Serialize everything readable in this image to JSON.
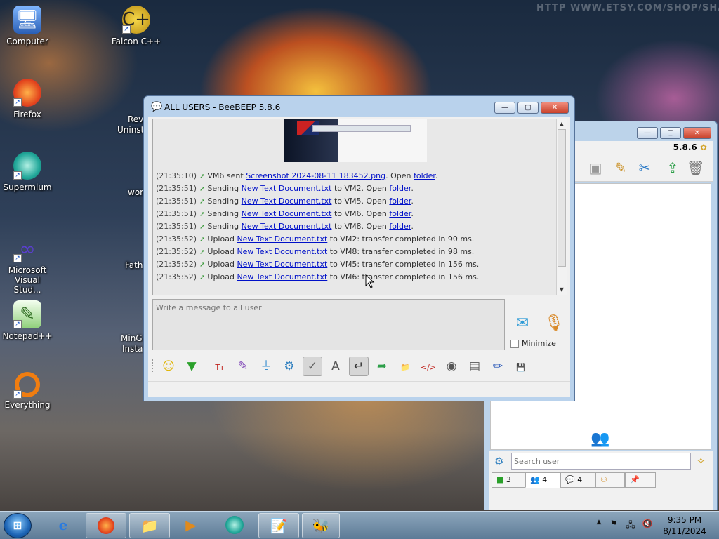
{
  "desktop": {
    "icons": [
      {
        "label": "Computer",
        "icon": "computer-icon",
        "shortcut": false
      },
      {
        "label": "Falcon C++",
        "icon": "falcon-cpp-icon",
        "shortcut": true
      },
      {
        "label": "Firefox",
        "icon": "firefox-icon",
        "shortcut": true
      },
      {
        "label": "Supermium",
        "icon": "supermium-icon",
        "shortcut": true
      },
      {
        "label": "Microsoft Visual Stud...",
        "icon": "visual-studio-icon",
        "shortcut": true
      },
      {
        "label": "Notepad++",
        "icon": "notepad-plus-plus-icon",
        "shortcut": true
      },
      {
        "label": "Everything",
        "icon": "everything-search-icon",
        "shortcut": true
      }
    ],
    "partial_labels": [
      "Revo",
      "Uninsta",
      "work",
      "Fathe",
      "MinG",
      "Install"
    ],
    "watermark": "HTTP WWW.ETSY.COM/SHOP/SHADPWA"
  },
  "main_window": {
    "title": "ALL USERS - BeeBEEP 5.8.6",
    "title_icon": "beebeep-chat-icon",
    "log": [
      {
        "time": "(21:35:10)",
        "parts": [
          {
            "t": "VM6 sent "
          },
          {
            "t": "Screenshot 2024-08-11 183452.png",
            "link": true
          },
          {
            "t": ". Open "
          },
          {
            "t": "folder",
            "link": true
          },
          {
            "t": "."
          }
        ]
      },
      {
        "time": "(21:35:51)",
        "parts": [
          {
            "t": "Sending "
          },
          {
            "t": "New Text Document.txt",
            "link": true
          },
          {
            "t": " to VM2. Open "
          },
          {
            "t": "folder",
            "link": true
          },
          {
            "t": "."
          }
        ]
      },
      {
        "time": "(21:35:51)",
        "parts": [
          {
            "t": "Sending "
          },
          {
            "t": "New Text Document.txt",
            "link": true
          },
          {
            "t": " to VM5. Open "
          },
          {
            "t": "folder",
            "link": true
          },
          {
            "t": "."
          }
        ]
      },
      {
        "time": "(21:35:51)",
        "parts": [
          {
            "t": "Sending "
          },
          {
            "t": "New Text Document.txt",
            "link": true
          },
          {
            "t": " to VM6. Open "
          },
          {
            "t": "folder",
            "link": true
          },
          {
            "t": "."
          }
        ]
      },
      {
        "time": "(21:35:51)",
        "parts": [
          {
            "t": "Sending "
          },
          {
            "t": "New Text Document.txt",
            "link": true
          },
          {
            "t": " to VM8. Open "
          },
          {
            "t": "folder",
            "link": true
          },
          {
            "t": "."
          }
        ]
      },
      {
        "time": "(21:35:52)",
        "parts": [
          {
            "t": "Upload "
          },
          {
            "t": "New Text Document.txt",
            "link": true
          },
          {
            "t": " to VM2: transfer completed in 90 ms."
          }
        ]
      },
      {
        "time": "(21:35:52)",
        "parts": [
          {
            "t": "Upload "
          },
          {
            "t": "New Text Document.txt",
            "link": true
          },
          {
            "t": " to VM8: transfer completed in 98 ms."
          }
        ]
      },
      {
        "time": "(21:35:52)",
        "parts": [
          {
            "t": "Upload "
          },
          {
            "t": "New Text Document.txt",
            "link": true
          },
          {
            "t": " to VM5: transfer completed in 156 ms."
          }
        ]
      },
      {
        "time": "(21:35:52)",
        "parts": [
          {
            "t": "Upload "
          },
          {
            "t": "New Text Document.txt",
            "link": true
          },
          {
            "t": " to VM6: transfer completed in 156 ms."
          }
        ]
      }
    ],
    "message_placeholder": "Write a message to all user",
    "minimize_label": "Minimize",
    "minimize_checked": false,
    "toolbar": [
      {
        "name": "emoticons-button",
        "glyph": "☺",
        "color": "#e0b400"
      },
      {
        "name": "show-more-button",
        "glyph": "▼",
        "color": "#2aa02a"
      },
      {
        "name": "font-button",
        "glyph": "Tт",
        "color": "#c0231d"
      },
      {
        "name": "font-color-button",
        "glyph": "✎",
        "color": "#7a3fb5"
      },
      {
        "name": "filter-button",
        "glyph": "⏚",
        "color": "#3a8fd0"
      },
      {
        "name": "settings-button",
        "glyph": "⚙",
        "color": "#2f7fbf"
      },
      {
        "name": "spell-check-button",
        "glyph": "✓",
        "color": "#666666",
        "pressed": true
      },
      {
        "name": "word-completer-button",
        "glyph": "A",
        "color": "#555555"
      },
      {
        "name": "use-return-to-send-button",
        "glyph": "↵",
        "color": "#333333",
        "pressed": true
      },
      {
        "name": "send-file-button",
        "glyph": "➦",
        "color": "#2e9f4a"
      },
      {
        "name": "send-folder-button",
        "glyph": "📁",
        "color": "#d09a22"
      },
      {
        "name": "html-code-button",
        "glyph": "</>",
        "color": "#c0231d"
      },
      {
        "name": "screenshot-button",
        "glyph": "◉",
        "color": "#555555"
      },
      {
        "name": "buzz-button",
        "glyph": "▤",
        "color": "#555555"
      },
      {
        "name": "edit-note-button",
        "glyph": "✏",
        "color": "#2a58b8"
      },
      {
        "name": "save-chat-button",
        "glyph": "💾",
        "color": "#2a58b8"
      }
    ]
  },
  "side_window": {
    "version": "5.8.6",
    "search_placeholder": "Search user",
    "tabs": [
      {
        "name": "tab-chats",
        "icon": "chat-list-icon",
        "count": "3"
      },
      {
        "name": "tab-users",
        "icon": "users-icon",
        "count": "4"
      },
      {
        "name": "tab-groups",
        "icon": "group-chat-icon",
        "count": "4"
      },
      {
        "name": "tab-workgroups",
        "icon": "workgroup-icon",
        "count": ""
      },
      {
        "name": "tab-pinned",
        "icon": "pin-icon",
        "count": ""
      }
    ]
  },
  "taskbar": {
    "clock_time": "9:35 PM",
    "clock_date": "8/11/2024",
    "apps": [
      {
        "name": "taskbar-internet-explorer",
        "icon": "internet-explorer-icon",
        "state": "pinned"
      },
      {
        "name": "taskbar-firefox",
        "icon": "firefox-icon",
        "state": "open"
      },
      {
        "name": "taskbar-file-explorer",
        "icon": "folder-icon",
        "state": "open"
      },
      {
        "name": "taskbar-media-player",
        "icon": "media-player-icon",
        "state": "pinned"
      },
      {
        "name": "taskbar-supermium",
        "icon": "supermium-icon",
        "state": "pinned"
      },
      {
        "name": "taskbar-notepad",
        "icon": "notepad-icon",
        "state": "open"
      },
      {
        "name": "taskbar-beebeep",
        "icon": "beebeep-icon",
        "state": "open"
      }
    ]
  },
  "colors": {
    "link": "#0010c8",
    "title_bar": "#b9d2ec",
    "close_button": "#c8412b"
  }
}
